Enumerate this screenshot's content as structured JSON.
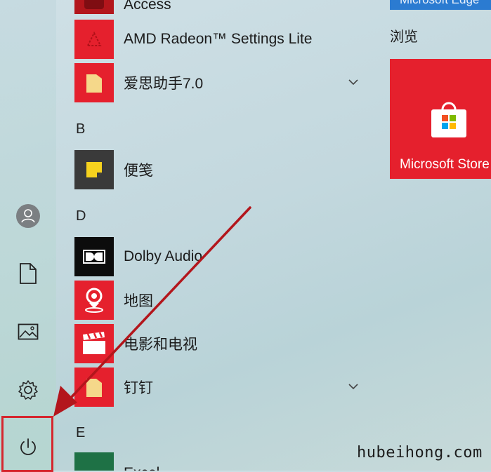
{
  "rail": {
    "items": [
      {
        "icon": "user-avatar-icon"
      },
      {
        "icon": "document-icon"
      },
      {
        "icon": "pictures-icon"
      },
      {
        "icon": "gear-icon"
      },
      {
        "icon": "power-icon"
      }
    ]
  },
  "app_list": {
    "partial_top_label": "Access",
    "rows": [
      {
        "name": "AMD Radeon™ Settings Lite"
      },
      {
        "name": "爱思助手7.0"
      },
      {
        "name": "便笺"
      },
      {
        "name": "Dolby Audio"
      },
      {
        "name": "地图"
      },
      {
        "name": "电影和电视"
      },
      {
        "name": "钉钉"
      },
      {
        "name": "Excel"
      }
    ],
    "letters": [
      "B",
      "D",
      "E"
    ]
  },
  "tiles": {
    "top_tile_label": "Microsoft Edge",
    "group_label": "浏览",
    "store_label": "Microsoft Store"
  },
  "annotation": {
    "highlight_color": "#d5262e",
    "arrow_color": "#b3161c"
  },
  "watermark": "hubeihong.com"
}
